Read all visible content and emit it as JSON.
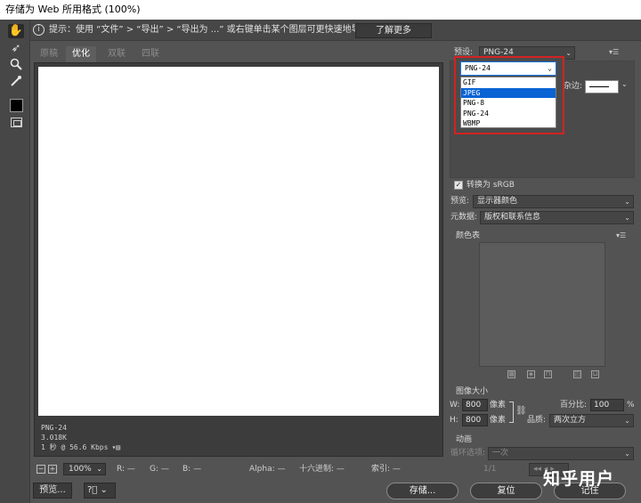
{
  "window": {
    "title": "存储为 Web 所用格式 (100%)"
  },
  "hint": {
    "text": "提示：使用 “文件” > “导出” > “导出为 ...” 或右键单击某个图层可更快速地导出资源",
    "learn_more": "了解更多"
  },
  "tabs": [
    {
      "label": "原稿",
      "active": false
    },
    {
      "label": "优化",
      "active": true
    },
    {
      "label": "双联",
      "active": false
    },
    {
      "label": "四联",
      "active": false
    }
  ],
  "canvas_info": {
    "format": "PNG-24",
    "size": "3.018K",
    "speed": "1 秒 @ 56.6 Kbps"
  },
  "status": {
    "zoom": "100%",
    "r": "R: —",
    "g": "G: —",
    "b": "B: —",
    "alpha": "Alpha: —",
    "hex": "十六进制: —",
    "index": "索引: —"
  },
  "bottom": {
    "preview": "预览...",
    "save": "存储...",
    "reset": "复位",
    "remember": "记住"
  },
  "preset": {
    "label": "预设:",
    "value": "PNG-24"
  },
  "format_dropdown": {
    "selected": "PNG-24",
    "options": [
      "GIF",
      "JPEG",
      "PNG-8",
      "PNG-24",
      "WBMP"
    ],
    "highlighted": "JPEG"
  },
  "matte": {
    "label": "杂边:"
  },
  "convert_srgb": {
    "label": "转换为 sRGB",
    "checked": true
  },
  "preview_mode": {
    "label": "预览:",
    "value": "显示器颜色"
  },
  "metadata": {
    "label": "元数据:",
    "value": "版权和联系信息"
  },
  "color_table": {
    "label": "颜色表"
  },
  "image_size": {
    "label": "图像大小",
    "w_label": "W:",
    "w_value": "800",
    "h_label": "H:",
    "h_value": "800",
    "unit": "像素",
    "percent_label": "百分比:",
    "percent_value": "100",
    "percent_unit": "%",
    "quality_label": "品质:",
    "quality_value": "两次立方"
  },
  "animation": {
    "label": "动画",
    "loop_label": "循环选项:",
    "loop_value": "一次",
    "frame": "1/1"
  },
  "watermark": "知乎用户",
  "colors": {
    "accent_red": "#d32222",
    "highlight_blue": "#0a64d4"
  }
}
